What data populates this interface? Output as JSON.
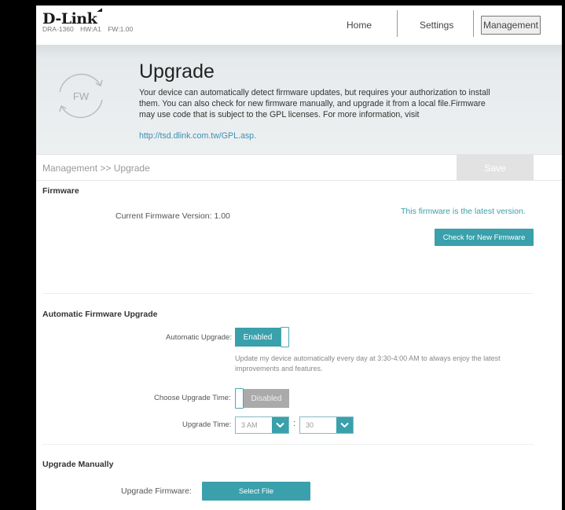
{
  "header": {
    "brand": "D-Link",
    "model": "DRA-1360",
    "hw": "HW:A1",
    "fw": "FW:1.00",
    "nav": {
      "home": "Home",
      "settings": "Settings",
      "management": "Management"
    }
  },
  "banner": {
    "icon_text": "FW",
    "title": "Upgrade",
    "description": "Your device can automatically detect firmware updates, but requires your authorization to install them. You can also check for new firmware manually, and upgrade it from a local file.Firmware may use code that is subject to the GPL licenses. For more information, visit",
    "link": "http://tsd.dlink.com.tw/GPL.asp."
  },
  "breadcrumb": "Management >> Upgrade",
  "save_label": "Save",
  "firmware": {
    "title": "Firmware",
    "current_version_label": "Current Firmware Version: 1.00",
    "status": "This firmware is the latest version.",
    "check_label": "Check for New Firmware"
  },
  "auto_upgrade": {
    "title": "Automatic Firmware Upgrade",
    "auto_label": "Automatic Upgrade:",
    "auto_state": "Enabled",
    "hint": "Update my device automatically every day at 3:30-4:00 AM to always enjoy the latest improvements and features.",
    "choose_time_label": "Choose Upgrade Time:",
    "choose_time_state": "Disabled",
    "time_label": "Upgrade Time:",
    "hour": "3 AM",
    "colon": ":",
    "minute": "30"
  },
  "manual": {
    "title": "Upgrade Manually",
    "label": "Upgrade Firmware:",
    "select_label": "Select File"
  },
  "colors": {
    "accent": "#3aa0ab",
    "link": "#3b8fb5"
  }
}
